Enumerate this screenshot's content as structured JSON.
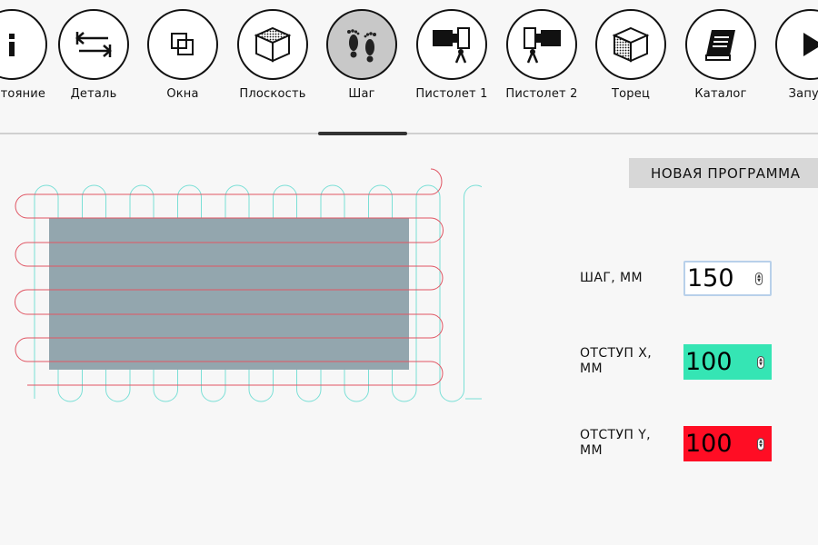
{
  "toolbar": {
    "items": [
      {
        "label": "Состояние",
        "icon": "info-icon"
      },
      {
        "label": "Деталь",
        "icon": "detail-arrows-icon"
      },
      {
        "label": "Окна",
        "icon": "windows-icon"
      },
      {
        "label": "Плоскость",
        "icon": "plane-cube-icon"
      },
      {
        "label": "Шаг",
        "icon": "footprints-icon",
        "active": true
      },
      {
        "label": "Пистолет 1",
        "icon": "gun-1-icon"
      },
      {
        "label": "Пистолет 2",
        "icon": "gun-2-icon"
      },
      {
        "label": "Торец",
        "icon": "edge-cube-icon"
      },
      {
        "label": "Каталог",
        "icon": "catalog-book-icon"
      },
      {
        "label": "Запуск",
        "icon": "play-icon"
      }
    ]
  },
  "actions": {
    "new_program": "НОВАЯ ПРОГРАММА"
  },
  "fields": {
    "step": {
      "label": "ШАГ, ММ",
      "value": "150"
    },
    "offset_x": {
      "label": "ОТСТУП X, ММ",
      "value": "100",
      "color": "#35e5b4"
    },
    "offset_y": {
      "label": "ОТСТУП Y, ММ",
      "value": "100",
      "color": "#ff0d24"
    }
  },
  "colors": {
    "part": "#93a6ae",
    "path_x": "#e05563",
    "path_y": "#7adfd6"
  }
}
